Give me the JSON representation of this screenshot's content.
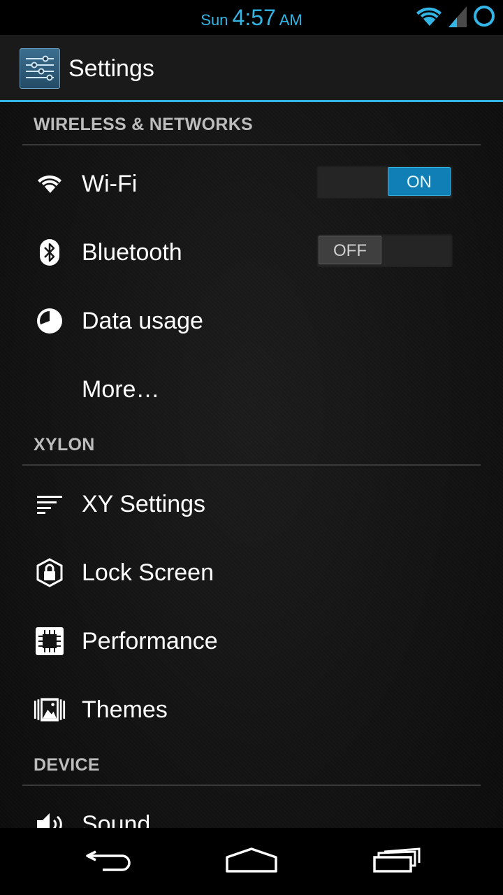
{
  "status_bar": {
    "day": "Sun",
    "time": "4:57",
    "ampm": "AM",
    "accent_color": "#33b5e5",
    "icons": [
      "wifi-signal-icon",
      "cell-signal-icon",
      "sync-ring-icon"
    ]
  },
  "action_bar": {
    "title": "Settings",
    "icon": "settings-sliders-icon"
  },
  "sections": [
    {
      "header": "WIRELESS & NETWORKS"
    },
    {
      "header": "XYLON"
    },
    {
      "header": "DEVICE"
    }
  ],
  "rows": {
    "wifi": {
      "label": "Wi-Fi",
      "icon": "wifi-icon",
      "toggle": "ON"
    },
    "bluetooth": {
      "label": "Bluetooth",
      "icon": "bluetooth-icon",
      "toggle": "OFF"
    },
    "data_usage": {
      "label": "Data usage",
      "icon": "data-usage-icon"
    },
    "more": {
      "label": "More…"
    },
    "xy_settings": {
      "label": "XY Settings",
      "icon": "sort-lines-icon"
    },
    "lock_screen": {
      "label": "Lock Screen",
      "icon": "lock-icon"
    },
    "performance": {
      "label": "Performance",
      "icon": "chip-icon"
    },
    "themes": {
      "label": "Themes",
      "icon": "image-gallery-icon"
    },
    "sound": {
      "label": "Sound",
      "icon": "speaker-icon"
    }
  },
  "nav_bar": {
    "buttons": [
      "back-icon",
      "home-icon",
      "recents-icon"
    ]
  },
  "colors": {
    "accent": "#33b5e5",
    "toggle_on": "#0f7fb5",
    "toggle_off": "#3f3f3f",
    "header_text": "#bdbdbd"
  }
}
